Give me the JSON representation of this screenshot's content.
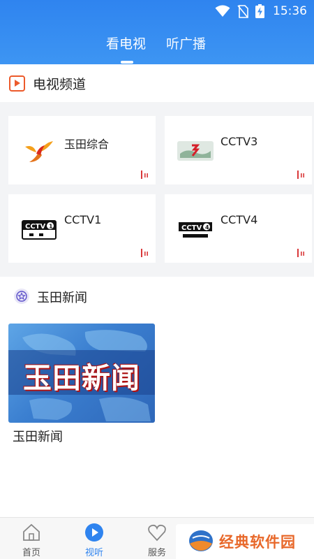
{
  "status_bar": {
    "time": "15:36"
  },
  "tabs": [
    {
      "label": "看电视",
      "active": true
    },
    {
      "label": "听广播",
      "active": false
    }
  ],
  "tv_section": {
    "title": "电视频道",
    "channels": [
      {
        "name": "玉田综合",
        "logo": "yutian-logo"
      },
      {
        "name": "CCTV3",
        "logo": "cctv3-logo"
      },
      {
        "name": "CCTV1",
        "logo": "cctv1-logo"
      },
      {
        "name": "CCTV4",
        "logo": "cctv4-logo"
      }
    ]
  },
  "news_section": {
    "title": "玉田新闻",
    "thumbnail_text": "玉田新闻",
    "item_caption": "玉田新闻"
  },
  "bottom_nav": [
    {
      "label": "首页",
      "icon": "home-icon"
    },
    {
      "label": "视听",
      "icon": "play-icon",
      "active": true
    },
    {
      "label": "服务",
      "icon": "heart-icon"
    },
    {
      "label": "",
      "icon": "grid-icon"
    },
    {
      "label": "",
      "icon": "circle-icon"
    }
  ],
  "watermark": {
    "text": "经典软件园"
  },
  "colors": {
    "primary": "#2f84ef",
    "accent": "#ec5a2b",
    "live": "#d9383a"
  }
}
